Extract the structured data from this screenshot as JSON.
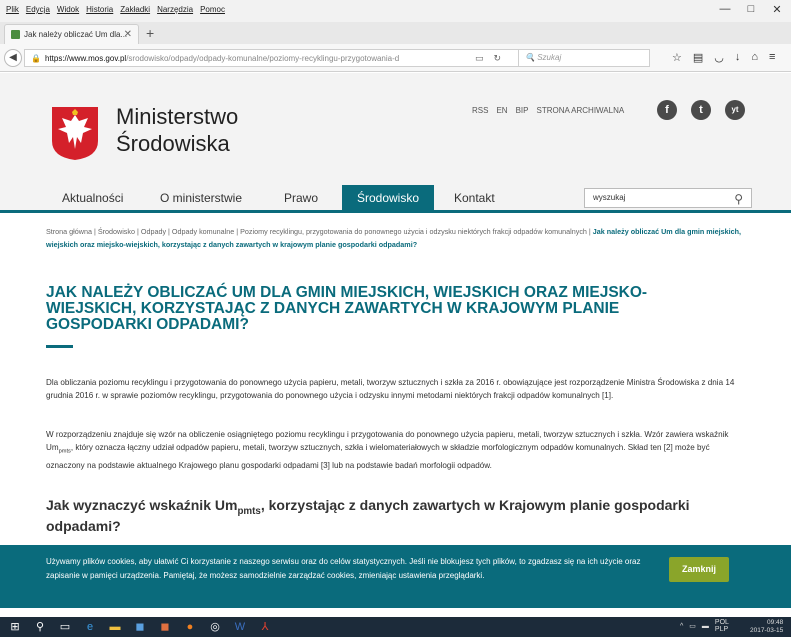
{
  "browser": {
    "menu": [
      "Plik",
      "Edycja",
      "Widok",
      "Historia",
      "Zakładki",
      "Narzędzia",
      "Pomoc"
    ],
    "window_controls": [
      "—",
      "□",
      "✕"
    ],
    "tab_title": "Jak należy obliczać Um dla...",
    "url_domain": "https://www.mos.gov.pl",
    "url_path": "/srodowisko/odpady/odpady-komunalne/poziomy-recyklingu-przygotowania-d",
    "search_placeholder": "Szukaj",
    "toolbar_icons": [
      "star-icon",
      "library-icon",
      "pocket-icon",
      "download-icon",
      "home-icon",
      "menu-icon"
    ]
  },
  "site": {
    "brand_line1": "Ministerstwo",
    "brand_line2": "Środowiska",
    "toplinks": [
      "RSS",
      "EN",
      "BIP",
      "STRONA ARCHIWALNA"
    ],
    "social": [
      "f",
      "t",
      "yt"
    ],
    "nav": [
      "Aktualności",
      "O ministerstwie",
      "Prawo",
      "Środowisko",
      "Kontakt"
    ],
    "search_value": "wyszukaj",
    "breadcrumb": [
      "Strona główna",
      "Środowisko",
      "Odpady",
      "Odpady komunalne",
      "Poziomy recyklingu, przygotowania do ponownego użycia i odzysku niektórych frakcji odpadów komunalnych"
    ],
    "breadcrumb_current": "Jak należy obliczać Um dla gmin miejskich, wiejskich oraz miejsko-wiejskich, korzystając z danych zawartych w krajowym planie gospodarki odpadami?",
    "title": "Jak należy obliczać Um dla gmin miejskich, wiejskich oraz miejsko-wiejskich, korzystając z danych zawartych w Krajowym planie gospodarki odpadami?",
    "para1": "Dla obliczania poziomu recyklingu i przygotowania do ponownego użycia papieru, metali, tworzyw sztucznych i szkła za 2016 r. obowiązujące jest rozporządzenie Ministra Środowiska z dnia 14 grudnia 2016 r. w sprawie poziomów recyklingu, przygotowania do ponownego użycia i odzysku innymi metodami niektórych frakcji odpadów komunalnych [1].",
    "para2_a": "W rozporządzeniu znajduje się wzór na obliczenie osiągniętego poziomu recyklingu i przygotowania do ponownego użycia papieru, metali, tworzyw sztucznych i szkła. Wzór zawiera wskaźnik Um",
    "para2_sub": "pmts",
    "para2_b": ", który oznacza łączny udział odpadów papieru, metali, tworzyw sztucznych, szkła i wielomateriałowych w składzie morfologicznym odpadów komunalnych. Skład ten [2] może być oznaczony na podstawie aktualnego Krajowego planu gospodarki odpadami [3] lub na podstawie badań morfologii odpadów.",
    "subhead_a": "Jak wyznaczyć wskaźnik Um",
    "subhead_sub": "pmts",
    "subhead_b": ", korzystając z danych zawartych w Krajowym planie gospodarki odpadami?"
  },
  "cookie": {
    "text": "Używamy plików cookies, aby ułatwić Ci korzystanie z naszego serwisu oraz do celów statystycznych. Jeśli nie blokujesz tych plików, to zgadzasz się na ich użycie oraz zapisanie w pamięci urządzenia. Pamiętaj, że możesz samodzielnie zarządzać cookies, zmieniając ustawienia przeglądarki.",
    "button": "Zamknij"
  },
  "taskbar": {
    "lang": "POL",
    "lang2": "PLP",
    "time": "09:48",
    "date": "2017-03-15"
  },
  "colors": {
    "accent": "#0a6b7c",
    "button_green": "#8aa52a"
  }
}
